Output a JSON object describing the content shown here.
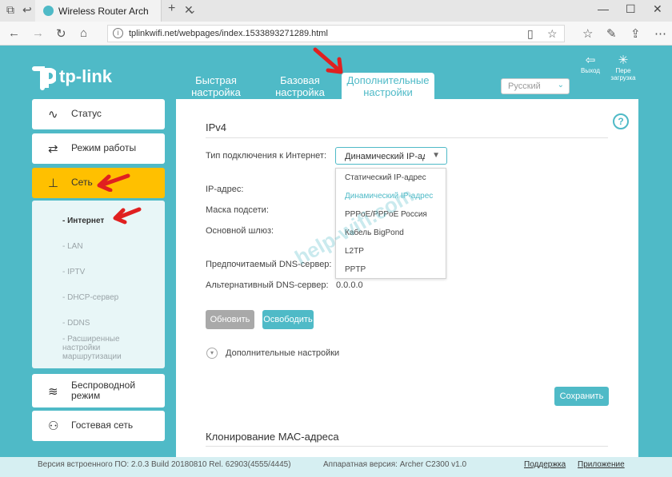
{
  "browser": {
    "tab_title": "Wireless Router Archer",
    "tab_close": "✕",
    "new_tab": "+",
    "tab_menu": "⌄",
    "url": "tplinkwifi.net/webpages/index.1533893271289.html",
    "win_minimize": "—",
    "win_maximize": "☐",
    "win_close": "✕"
  },
  "header": {
    "logo": "tp-link",
    "tabs": [
      {
        "label": "Быстрая настройка"
      },
      {
        "label": "Базовая настройка"
      },
      {
        "label": "Дополнительные настройки"
      }
    ],
    "language": "Русский",
    "logout_label": "Выход",
    "reboot_label": "Пере загрузка"
  },
  "sidebar": {
    "items": [
      {
        "label": "Статус",
        "icon": "pulse-icon"
      },
      {
        "label": "Режим работы",
        "icon": "switch-icon"
      },
      {
        "label": "Сеть",
        "icon": "network-icon"
      },
      {
        "label": "Беспроводной режим",
        "icon": "wifi-icon"
      },
      {
        "label": "Гостевая сеть",
        "icon": "guest-users-icon"
      }
    ],
    "subitems": [
      "- Интернет",
      "- LAN",
      "- IPTV",
      "- DHCP-сервер",
      "- DDNS",
      "- Расширенные настройки маршрутизации"
    ]
  },
  "main": {
    "section_title": "IPv4",
    "connection_type_label": "Тип подключения к Интернет:",
    "connection_type_value": "Динамический IP-адрес",
    "options": [
      "Статический IP-адрес",
      "Динамический IP-адрес",
      "PPPoE/PPPoE Россия",
      "Кабель BigPond",
      "L2TP",
      "PPTP"
    ],
    "ip_label": "IP-адрес:",
    "mask_label": "Маска подсети:",
    "gateway_label": "Основной шлюз:",
    "dns1_label": "Предпочитаемый DNS-сервер:",
    "dns2_label": "Альтернативный DNS-сервер:",
    "dns2_value": "0.0.0.0",
    "renew_button": "Обновить",
    "release_button": "Освободить",
    "advanced_label": "Дополнительные настройки",
    "save_button": "Сохранить",
    "mac_clone_title": "Клонирование МАС-адреса"
  },
  "footer": {
    "firmware": "Версия встроенного ПО: 2.0.3 Build 20180810 Rel. 62903(4555/4445)",
    "hardware": "Аппаратная версия: Archer C2300 v1.0",
    "support": "Поддержка",
    "app": "Приложение"
  },
  "watermark": "help-wifi.com",
  "colors": {
    "accent": "#4fbac7",
    "active_nav": "#ffc000",
    "annotation_arrow": "#e02020"
  }
}
